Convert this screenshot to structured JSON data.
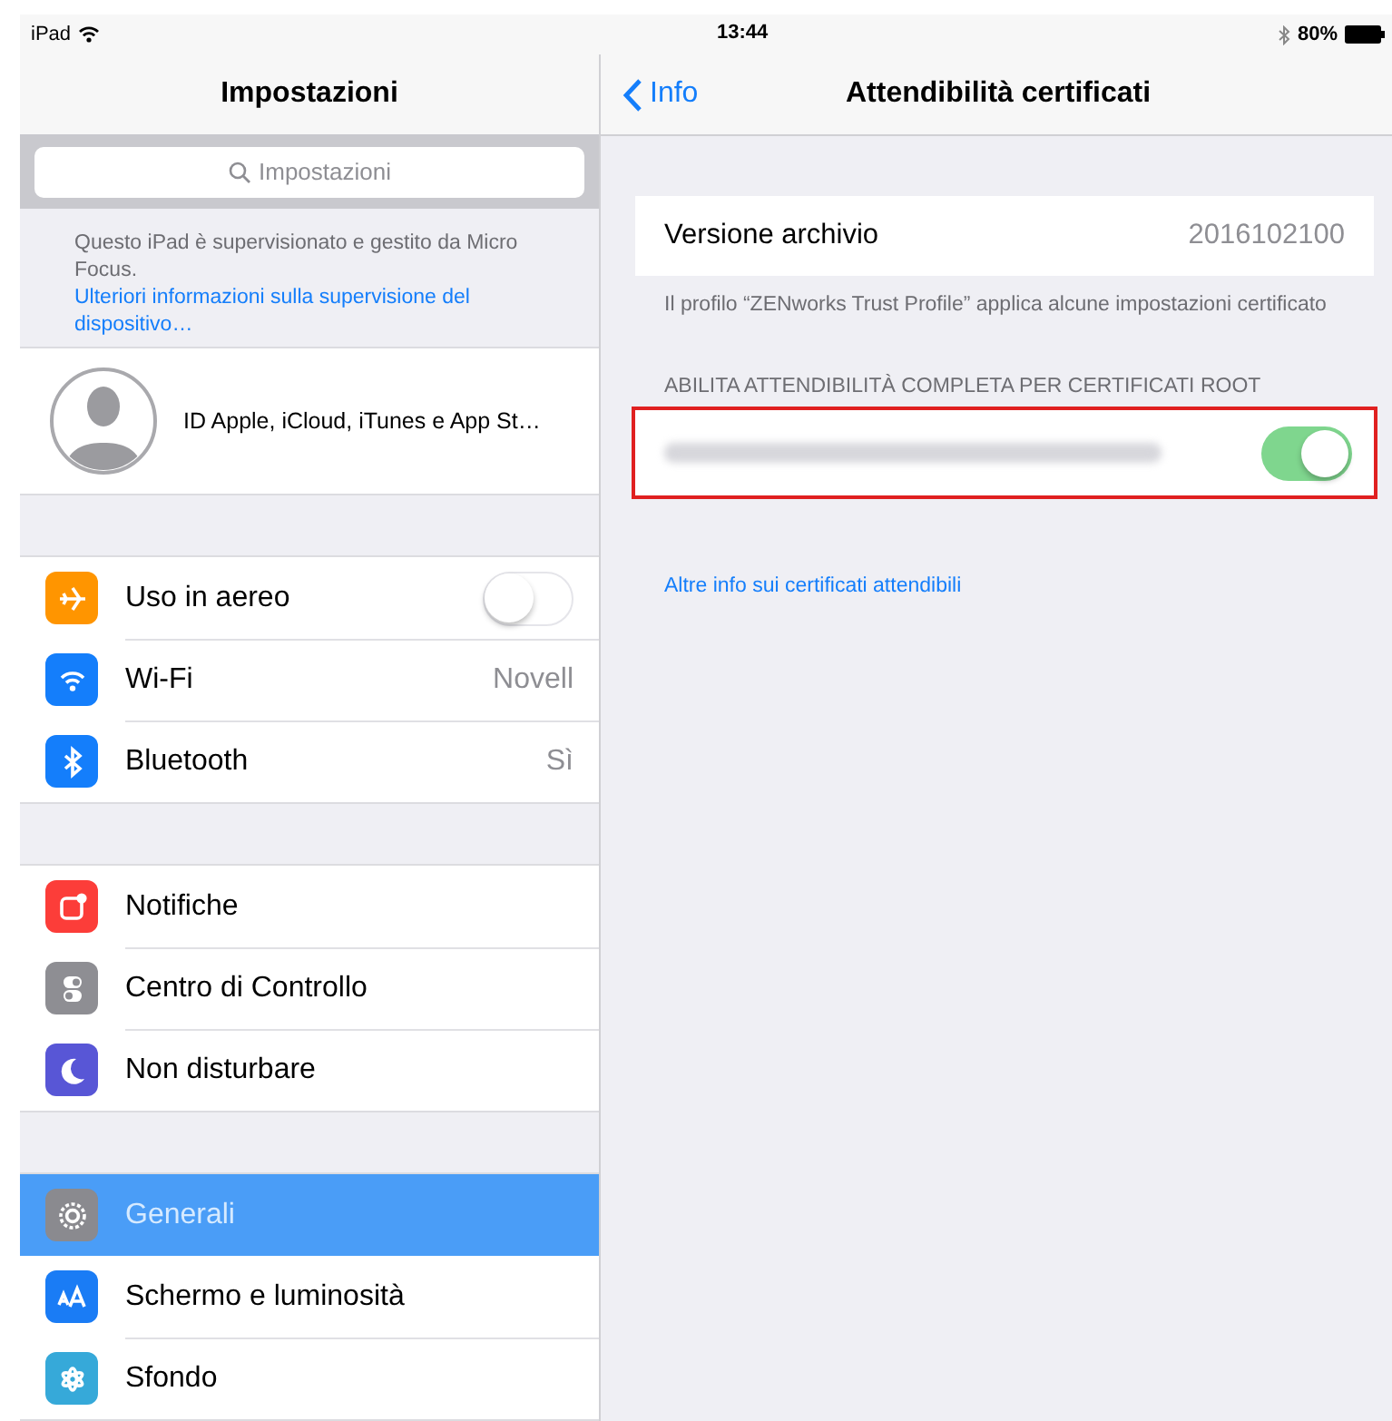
{
  "status_bar": {
    "device": "iPad",
    "time": "13:44",
    "battery": "80%"
  },
  "master": {
    "title": "Impostazioni",
    "search": {
      "placeholder": "Impostazioni"
    },
    "supervision": {
      "text": "Questo iPad è supervisionato e gestito da Micro Focus.",
      "link": "Ulteriori informazioni sulla supervisione del dispositivo…"
    },
    "account": {
      "label": "ID Apple, iCloud, iTunes e App St…"
    },
    "groups": [
      [
        {
          "kind": "toggle",
          "color": "#ff9500",
          "label": "Uso in aereo",
          "on": false,
          "selected": false
        },
        {
          "kind": "value",
          "color": "#147efb",
          "label": "Wi-Fi",
          "value": "Novell",
          "selected": false
        },
        {
          "kind": "value",
          "color": "#147efb",
          "label": "Bluetooth",
          "value": "Sì",
          "selected": false
        }
      ],
      [
        {
          "kind": "plain",
          "color": "#fc3d39",
          "label": "Notifiche",
          "selected": false
        },
        {
          "kind": "plain",
          "color": "#8e8e93",
          "label": "Centro di Controllo",
          "selected": false
        },
        {
          "kind": "plain",
          "color": "#5856d6",
          "label": "Non disturbare",
          "selected": false
        }
      ],
      [
        {
          "kind": "plain",
          "color": "#8a8a8f",
          "label": "Generali",
          "selected": true
        },
        {
          "kind": "plain",
          "color": "#1a7cf5",
          "label": "Schermo e luminosità",
          "selected": false
        },
        {
          "kind": "plain",
          "color": "#36a9d9",
          "label": "Sfondo",
          "selected": false
        }
      ]
    ]
  },
  "detail": {
    "back": "Info",
    "title": "Attendibilità certificati",
    "version": {
      "label": "Versione archivio",
      "value": "2016102100"
    },
    "footer": "Il profilo “ZENworks Trust Profile” applica alcune impostazioni certificato",
    "section_header": "ABILITA ATTENDIBILITÀ COMPLETA PER CERTIFICATI ROOT",
    "certificates": [
      {
        "on": true,
        "highlighted": true
      }
    ],
    "link": "Altre info sui certificati attendibili"
  }
}
